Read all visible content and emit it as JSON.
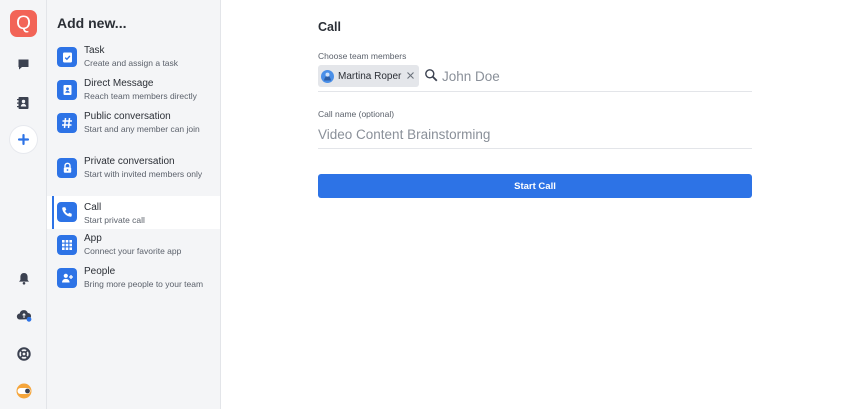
{
  "app": {
    "logo_letter": "Q",
    "brand_color": "#f26457",
    "accent_color": "#2d73e6"
  },
  "rail": {
    "top_icons": [
      "chat-icon",
      "contacts-icon",
      "plus-icon"
    ],
    "bottom_icons": [
      "bell-icon",
      "cloud-upload-icon",
      "help-lifebuoy-icon",
      "status-toggle-icon"
    ]
  },
  "panel": {
    "title": "Add new...",
    "items": [
      {
        "title": "Task",
        "subtitle": "Create and assign a task",
        "icon": "task-check-icon"
      },
      {
        "title": "Direct Message",
        "subtitle": "Reach team members directly",
        "icon": "contact-card-icon"
      },
      {
        "title": "Public conversation",
        "subtitle": "Start and any member can join",
        "icon": "hashtag-icon"
      },
      {
        "title": "Private conversation",
        "subtitle": "Start with invited members only",
        "icon": "lock-icon"
      },
      {
        "title": "Call",
        "subtitle": "Start private call",
        "icon": "phone-icon",
        "active": true
      },
      {
        "title": "App",
        "subtitle": "Connect your favorite app",
        "icon": "apps-grid-icon"
      },
      {
        "title": "People",
        "subtitle": "Bring more people to your team",
        "icon": "add-person-icon"
      }
    ]
  },
  "form": {
    "title": "Call",
    "members_label": "Choose team members",
    "selected_member": "Martina Roper",
    "member_placeholder": "John Doe",
    "call_name_label": "Call name (optional)",
    "call_name_placeholder": "Video Content Brainstorming",
    "start_button": "Start Call"
  }
}
